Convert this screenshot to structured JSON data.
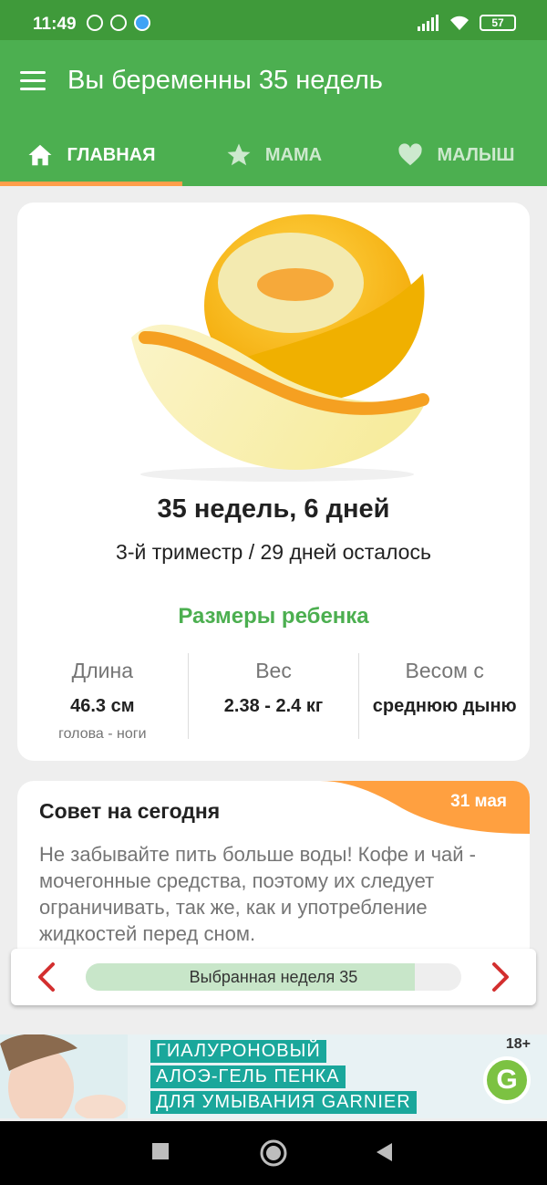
{
  "status_bar": {
    "time": "11:49",
    "battery": "57"
  },
  "app_bar": {
    "title": "Вы беременны 35 недель"
  },
  "tabs": [
    {
      "label": "ГЛАВНАЯ",
      "icon": "home-icon",
      "active": true
    },
    {
      "label": "МАМА",
      "icon": "star-icon",
      "active": false
    },
    {
      "label": "МАЛЫШ",
      "icon": "heart-icon",
      "active": false
    }
  ],
  "main_card": {
    "image": "melon-image",
    "week_title": "35 недель, 6 дней",
    "week_subtitle": "3-й триместр / 29 дней осталось",
    "sizes_heading": "Размеры ребенка",
    "stats": [
      {
        "label": "Длина",
        "value": "46.3 см",
        "note": "голова - ноги"
      },
      {
        "label": "Вес",
        "value": "2.38 - 2.4 кг",
        "note": ""
      },
      {
        "label": "Весом с",
        "value": "среднюю дыню",
        "note": ""
      }
    ]
  },
  "tip_card": {
    "heading": "Совет на сегодня",
    "date": "31 мая",
    "text": "Не забывайте пить больше воды! Кофе и чай - мочегонные средства, поэтому их следует ограничивать, так же, как и употребление жидкостей перед сном."
  },
  "week_nav": {
    "label": "Выбранная неделя 35",
    "progress_fraction": 0.875
  },
  "ad": {
    "lines": [
      "ГИАЛУРОНОВЫЙ",
      "АЛОЭ-ГЕЛЬ ПЕНКА",
      "ДЛЯ УМЫВАНИЯ GARNIER"
    ],
    "age": "18+",
    "logo": "G"
  },
  "colors": {
    "status_bar": "#3f9a3a",
    "app_bar": "#4caf50",
    "tab_indicator": "#ff9e4a",
    "accent_green": "#4caf50",
    "nav_arrow": "#d32f2f",
    "progress_fill": "#c8e6c9"
  }
}
